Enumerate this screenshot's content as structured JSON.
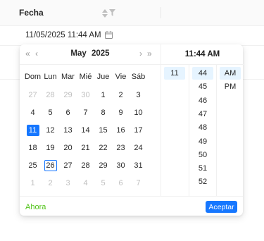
{
  "table": {
    "column_title": "Fecha"
  },
  "date_input": {
    "value": "11/05/2025 11:44 AM"
  },
  "calendar": {
    "month": "May",
    "year": "2025",
    "weekdays": [
      "Dom",
      "Lun",
      "Mar",
      "Mié",
      "Jue",
      "Vie",
      "Sáb"
    ],
    "weeks": [
      [
        {
          "d": "27",
          "o": true
        },
        {
          "d": "28",
          "o": true
        },
        {
          "d": "29",
          "o": true
        },
        {
          "d": "30",
          "o": true
        },
        {
          "d": "1"
        },
        {
          "d": "2"
        },
        {
          "d": "3"
        }
      ],
      [
        {
          "d": "4"
        },
        {
          "d": "5"
        },
        {
          "d": "6"
        },
        {
          "d": "7"
        },
        {
          "d": "8"
        },
        {
          "d": "9"
        },
        {
          "d": "10"
        }
      ],
      [
        {
          "d": "11",
          "sel": true
        },
        {
          "d": "12"
        },
        {
          "d": "13"
        },
        {
          "d": "14"
        },
        {
          "d": "15"
        },
        {
          "d": "16"
        },
        {
          "d": "17"
        }
      ],
      [
        {
          "d": "18"
        },
        {
          "d": "19"
        },
        {
          "d": "20"
        },
        {
          "d": "21"
        },
        {
          "d": "22"
        },
        {
          "d": "23"
        },
        {
          "d": "24"
        }
      ],
      [
        {
          "d": "25"
        },
        {
          "d": "26",
          "today": true
        },
        {
          "d": "27"
        },
        {
          "d": "28"
        },
        {
          "d": "29"
        },
        {
          "d": "30"
        },
        {
          "d": "31"
        }
      ],
      [
        {
          "d": "1",
          "o": true
        },
        {
          "d": "2",
          "o": true
        },
        {
          "d": "3",
          "o": true
        },
        {
          "d": "4",
          "o": true
        },
        {
          "d": "5",
          "o": true
        },
        {
          "d": "6",
          "o": true
        },
        {
          "d": "7",
          "o": true
        }
      ]
    ]
  },
  "time": {
    "header": "11:44 AM",
    "hours": [
      {
        "v": "11",
        "sel": true
      }
    ],
    "minutes": [
      {
        "v": "44",
        "sel": true
      },
      {
        "v": "45"
      },
      {
        "v": "46"
      },
      {
        "v": "47"
      },
      {
        "v": "48"
      },
      {
        "v": "49"
      },
      {
        "v": "50"
      },
      {
        "v": "51"
      },
      {
        "v": "52"
      }
    ],
    "meridiem": [
      {
        "v": "AM",
        "sel": true
      },
      {
        "v": "PM"
      }
    ]
  },
  "footer": {
    "now_label": "Ahora",
    "ok_label": "Aceptar"
  },
  "colors": {
    "accent": "#1677ff",
    "selected_time_bg": "#e6f4ff",
    "now_link": "#52c41a"
  }
}
